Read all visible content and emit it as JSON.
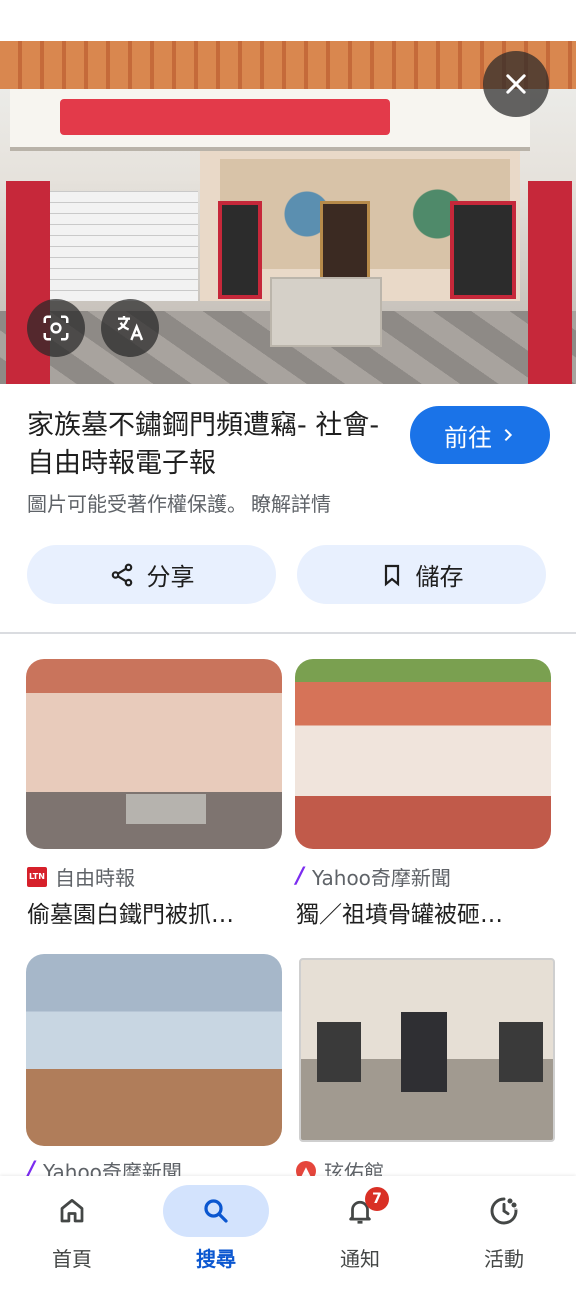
{
  "result": {
    "title": "家族墓不鏽鋼門頻遭竊- 社會- 自由時報電子報",
    "visit_label": "前往",
    "copyright_notice": "圖片可能受著作權保護。",
    "learn_more": "瞭解詳情"
  },
  "actions": {
    "share_label": "分享",
    "save_label": "儲存"
  },
  "related": [
    {
      "source": "自由時報",
      "source_icon": "ltn-logo",
      "title": "偷墓園白鐵門被抓…"
    },
    {
      "source": "Yahoo奇摩新聞",
      "source_icon": "yahoo-logo",
      "title": "獨／祖墳骨罐被砸…"
    },
    {
      "source": "Yahoo奇摩新聞",
      "source_icon": "yahoo-logo",
      "title": ""
    },
    {
      "source": "玹佑館",
      "source_icon": "site-logo",
      "title": ""
    }
  ],
  "nav": {
    "items": [
      {
        "label": "首頁",
        "icon": "home-icon"
      },
      {
        "label": "搜尋",
        "icon": "search-icon",
        "active": true
      },
      {
        "label": "通知",
        "icon": "bell-icon",
        "badge": "7"
      },
      {
        "label": "活動",
        "icon": "activity-icon"
      }
    ]
  },
  "colors": {
    "accent": "#1a73e8",
    "pill_bg": "#e8f0fe",
    "badge": "#d93025"
  }
}
